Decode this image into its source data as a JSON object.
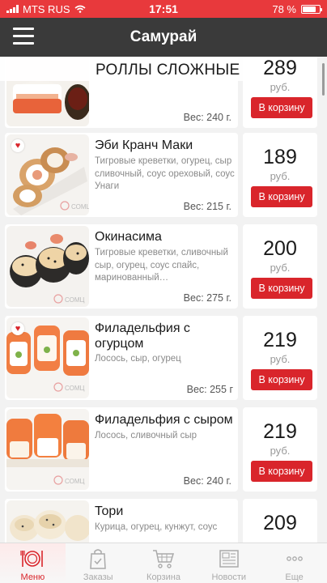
{
  "status_bar": {
    "carrier": "MTS RUS",
    "time": "17:51",
    "battery": "78 %",
    "battery_level": 0.78
  },
  "header": {
    "title": "Самурай"
  },
  "section": {
    "title": "РОЛЛЫ СЛОЖНЫЕ"
  },
  "brand": {
    "accent": "#d9252b",
    "status_bar": "#e8393c",
    "nav_bar": "#3a3a3a"
  },
  "items": [
    {
      "name": "",
      "description": "",
      "weight": "Вес: 240 г.",
      "price": "289",
      "currency": "руб.",
      "button": "В корзину",
      "favorite": false
    },
    {
      "name": "Эби Кранч Маки",
      "description": "Тигровые креветки, огурец, сыр сливочный, соус ореховый, соус Унаги",
      "weight": "Вес: 215 г.",
      "price": "189",
      "currency": "руб.",
      "button": "В корзину",
      "favorite": true
    },
    {
      "name": "Окинасима",
      "description": "Тигровые креветки, сливочный сыр, огурец, соус спайс, маринованный…",
      "weight": "Вес: 275 г.",
      "price": "200",
      "currency": "руб.",
      "button": "В корзину",
      "favorite": false
    },
    {
      "name": "Филадельфия с огурцом",
      "description": "Лосось, сыр, огурец",
      "weight": "Вес: 255 г",
      "price": "219",
      "currency": "руб.",
      "button": "В корзину",
      "favorite": true
    },
    {
      "name": "Филадельфия с сыром",
      "description": "Лосось, сливочный сыр",
      "weight": "Вес: 240 г.",
      "price": "219",
      "currency": "руб.",
      "button": "В корзину",
      "favorite": false
    },
    {
      "name": "Тори",
      "description": "Курица, огурец, кунжут, соус",
      "weight": "",
      "price": "209",
      "currency": "",
      "button": "",
      "favorite": false
    }
  ],
  "tabs": [
    {
      "label": "Меню",
      "icon": "plate-icon",
      "active": true
    },
    {
      "label": "Заказы",
      "icon": "bag-icon",
      "active": false
    },
    {
      "label": "Корзина",
      "icon": "cart-icon",
      "active": false
    },
    {
      "label": "Новости",
      "icon": "newspaper-icon",
      "active": false
    },
    {
      "label": "Еще",
      "icon": "more-icon",
      "active": false
    }
  ]
}
